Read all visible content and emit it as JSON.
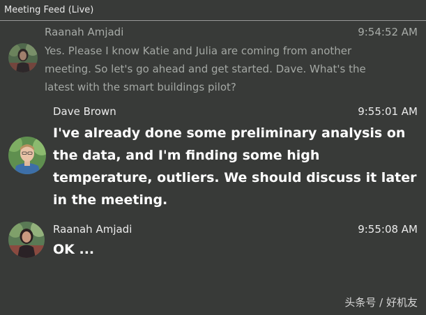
{
  "header": {
    "title": "Meeting Feed (Live)"
  },
  "messages": [
    {
      "sender": "Raanah Amjadi",
      "time": "9:54:52 AM",
      "text": "Yes. Please I know Katie and Julia are coming from another meeting. So let's go ahead and get started. Dave. What's the latest with the smart buildings pilot?",
      "avatar": "raanah-avatar"
    },
    {
      "sender": "Dave Brown",
      "time": "9:55:01 AM",
      "text": "I've already done some preliminary analysis on the data, and I'm finding some high temperature, outliers. We should discuss it later in the meeting.",
      "avatar": "dave-avatar"
    },
    {
      "sender": "Raanah Amjadi",
      "time": "9:55:08 AM",
      "text": "OK ...",
      "avatar": "raanah-avatar"
    }
  ],
  "watermark": "头条号 / 好机友",
  "colors": {
    "background": "#383a38",
    "divider": "#9a9a9a",
    "faded_text": "#a4a8a4",
    "active_text": "#ffffff"
  }
}
